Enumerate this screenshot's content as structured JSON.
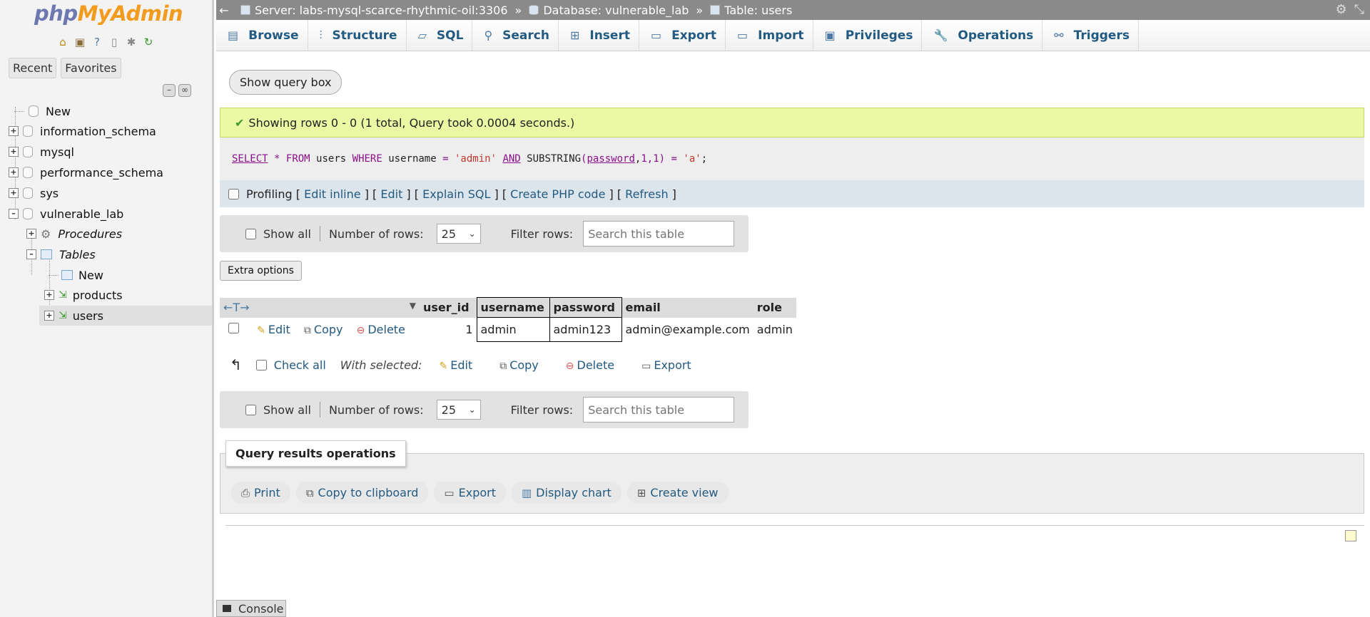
{
  "sidebar": {
    "logo_php": "php",
    "logo_myadmin": "MyAdmin",
    "nav_tabs": [
      "Recent",
      "Favorites"
    ],
    "tree": [
      {
        "label": "New"
      },
      {
        "label": "information_schema"
      },
      {
        "label": "mysql"
      },
      {
        "label": "performance_schema"
      },
      {
        "label": "sys"
      },
      {
        "label": "vulnerable_lab"
      },
      {
        "label": "Procedures"
      },
      {
        "label": "Tables"
      },
      {
        "label": "New"
      },
      {
        "label": "products"
      },
      {
        "label": "users"
      }
    ]
  },
  "breadcrumb": {
    "server": "Server: labs-mysql-scarce-rhythmic-oil:3306",
    "database": "Database: vulnerable_lab",
    "table": "Table: users",
    "separator": "»"
  },
  "tabs": [
    "Browse",
    "Structure",
    "SQL",
    "Search",
    "Insert",
    "Export",
    "Import",
    "Privileges",
    "Operations",
    "Triggers"
  ],
  "show_query_box": "Show query box",
  "success_message": "Showing rows 0 - 0 (1 total, Query took 0.0004 seconds.)",
  "sql": {
    "select": "SELECT",
    "star": "*",
    "from": "FROM",
    "table": "users",
    "where": "WHERE",
    "col1": "username",
    "eq": "=",
    "val1": "'admin'",
    "and": "AND",
    "fn": "SUBSTRING",
    "col2": "password",
    "args": "1,1",
    "val2": "'a'",
    "end": ";"
  },
  "profiling": {
    "label": "Profiling",
    "links": [
      "Edit inline",
      "Edit",
      "Explain SQL",
      "Create PHP code",
      "Refresh"
    ]
  },
  "nav": {
    "show_all": "Show all",
    "rows_label": "Number of rows:",
    "rows_value": "25",
    "filter_label": "Filter rows:",
    "filter_placeholder": "Search this table"
  },
  "extra_options": "Extra options",
  "table": {
    "columns": [
      "user_id",
      "username",
      "password",
      "email",
      "role"
    ],
    "row_actions": [
      "Edit",
      "Copy",
      "Delete"
    ],
    "rows": [
      {
        "user_id": "1",
        "username": "admin",
        "password": "admin123",
        "email": "admin@example.com",
        "role": "admin"
      }
    ]
  },
  "bulk": {
    "check_all": "Check all",
    "with_selected": "With selected:",
    "actions": [
      "Edit",
      "Copy",
      "Delete",
      "Export"
    ]
  },
  "query_results_operations": {
    "legend": "Query results operations",
    "buttons": [
      "Print",
      "Copy to clipboard",
      "Export",
      "Display chart",
      "Create view"
    ]
  },
  "console": "Console"
}
